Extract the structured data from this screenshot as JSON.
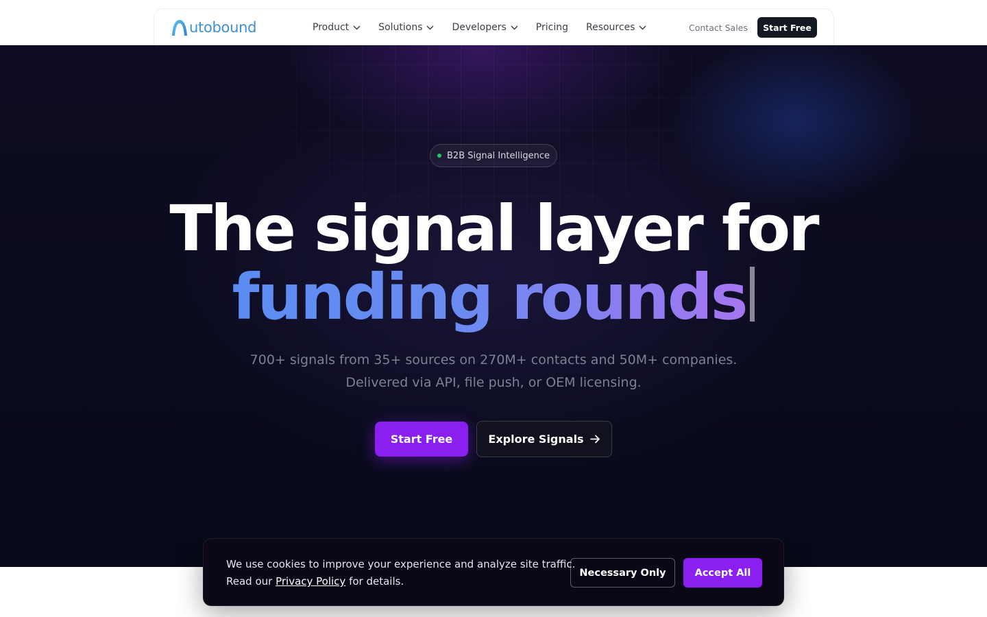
{
  "nav": {
    "logo_text": "utobound",
    "items": [
      {
        "label": "Product",
        "has_dropdown": true
      },
      {
        "label": "Solutions",
        "has_dropdown": true
      },
      {
        "label": "Developers",
        "has_dropdown": true
      },
      {
        "label": "Pricing",
        "has_dropdown": false
      },
      {
        "label": "Resources",
        "has_dropdown": true
      }
    ],
    "contact_label": "Contact Sales",
    "start_label": "Start Free"
  },
  "hero": {
    "badge": "B2B Signal Intelligence",
    "headline_line1": "The signal layer for",
    "headline_line2": "funding rounds",
    "subtitle_line1": "700+ signals from 35+ sources on 270M+ contacts and 50M+ companies.",
    "subtitle_line2": "Delivered via API, file push, or OEM licensing.",
    "primary_cta": "Start Free",
    "secondary_cta": "Explore Signals"
  },
  "cookie": {
    "text_line1": "We use cookies to improve your experience and analyze site traffic.",
    "text_prefix": "Read our ",
    "link_text": "Privacy Policy",
    "text_suffix": " for details.",
    "necessary_label": "Necessary Only",
    "accept_label": "Accept All"
  },
  "colors": {
    "brand_blue": "#3d8fd6",
    "accent_purple": "#8b1ff0",
    "hero_bg": "#0b0b1f",
    "nav_dark_button": "#141822"
  }
}
